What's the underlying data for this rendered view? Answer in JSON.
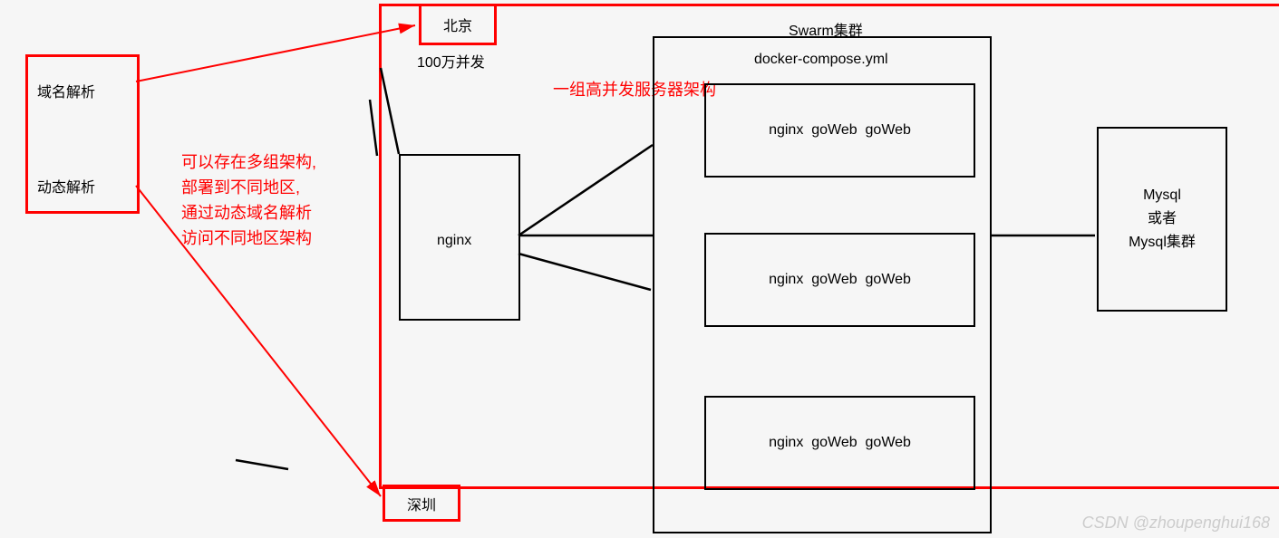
{
  "dns_box": {
    "line1": "域名解析",
    "line2": "动态解析"
  },
  "region_top": "北京",
  "region_bottom": "深圳",
  "concurrency": "100万并发",
  "multi_region_note": "可以存在多组架构,\n部署到不同地区,\n通过动态域名解析\n访问不同地区架构",
  "high_conc_title": "一组高并发服务器架构",
  "nginx_box": "nginx",
  "swarm_title": "Swarm集群",
  "compose_title": "docker-compose.yml",
  "services_line": "nginx  goWeb  goWeb",
  "mysql_box": "Mysql\n或者\nMysql集群",
  "watermark": "CSDN @zhoupenghui168"
}
